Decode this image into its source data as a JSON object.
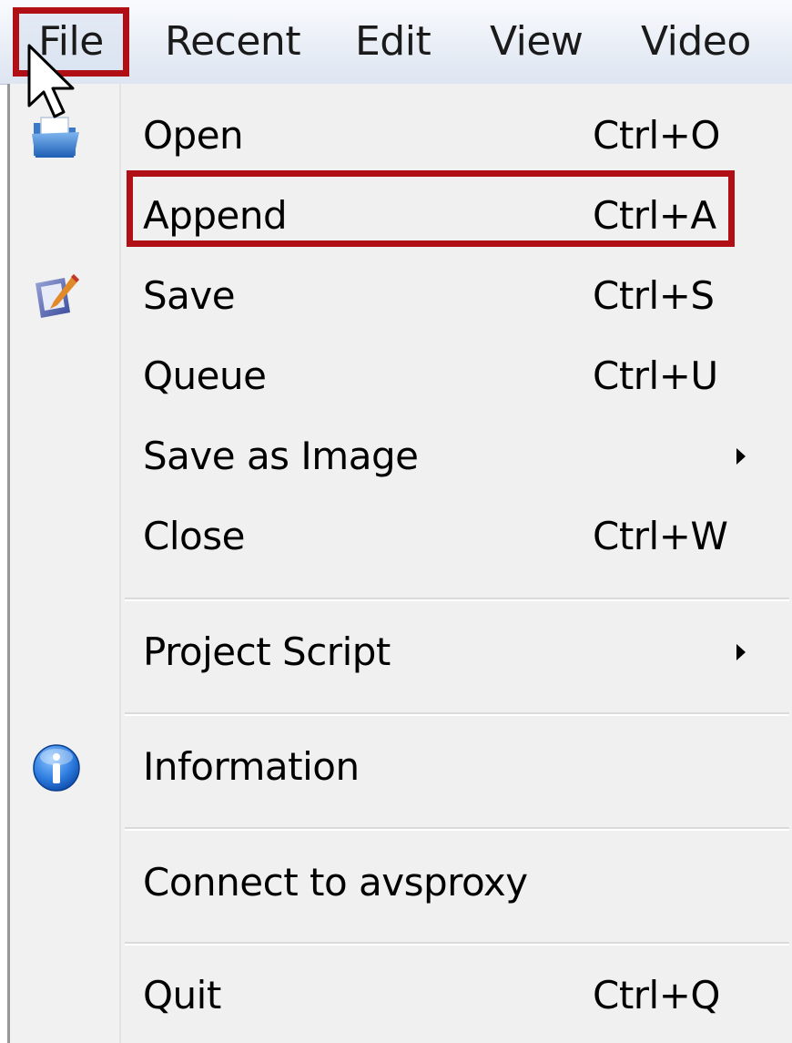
{
  "menubar": {
    "items": [
      {
        "id": "mb-file",
        "label": "File"
      },
      {
        "id": "mb-recent",
        "label": "Recent"
      },
      {
        "id": "mb-edit",
        "label": "Edit"
      },
      {
        "id": "mb-view",
        "label": "View"
      },
      {
        "id": "mb-video",
        "label": "Video"
      }
    ],
    "active": "File"
  },
  "file_menu": {
    "items": [
      {
        "label": "Open",
        "shortcut": "Ctrl+O",
        "icon": "open-folder-icon",
        "submenu": false
      },
      {
        "label": "Append",
        "shortcut": "Ctrl+A",
        "icon": "",
        "submenu": false,
        "highlighted": true
      },
      {
        "label": "Save",
        "shortcut": "Ctrl+S",
        "icon": "save-edit-icon",
        "submenu": false
      },
      {
        "label": "Queue",
        "shortcut": "Ctrl+U",
        "icon": "",
        "submenu": false
      },
      {
        "label": "Save as Image",
        "shortcut": "",
        "icon": "",
        "submenu": true
      },
      {
        "label": "Close",
        "shortcut": "Ctrl+W",
        "icon": "",
        "submenu": false
      },
      {
        "label": "Project Script",
        "shortcut": "",
        "icon": "",
        "submenu": true
      },
      {
        "label": "Information",
        "shortcut": "",
        "icon": "info-icon",
        "submenu": false
      },
      {
        "label": "Connect to avsproxy",
        "shortcut": "",
        "icon": "",
        "submenu": false
      },
      {
        "label": "Quit",
        "shortcut": "Ctrl+Q",
        "icon": "",
        "submenu": false
      }
    ]
  },
  "colors": {
    "highlight_outline": "#b01015",
    "menu_background": "#f0f0f0",
    "menubar_background": "#e9eef6"
  }
}
